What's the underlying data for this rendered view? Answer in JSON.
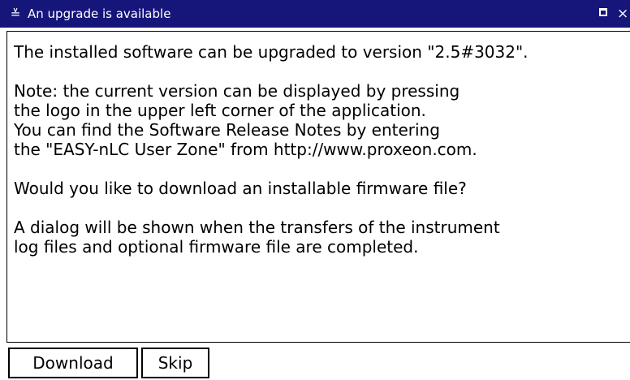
{
  "window": {
    "title": "An upgrade is available",
    "menu_icon": "≚",
    "close_icon": "×"
  },
  "message": {
    "lines": [
      "The installed software can be upgraded to version \"2.5#3032\".",
      "",
      "Note: the current version can be displayed by pressing",
      "the logo in the upper left corner of the application.",
      "You can find the Software Release Notes by entering",
      "the \"EASY-nLC User Zone\" from http://www.proxeon.com.",
      "",
      "Would you like to download an installable firmware file?",
      "",
      "A dialog will be shown when the transfers of the instrument",
      "log files and optional firmware file are completed."
    ]
  },
  "buttons": {
    "download_label": "Download",
    "skip_label": "Skip"
  },
  "colors": {
    "titlebar": "#15157a",
    "background": "#ffffff",
    "text": "#000000"
  }
}
